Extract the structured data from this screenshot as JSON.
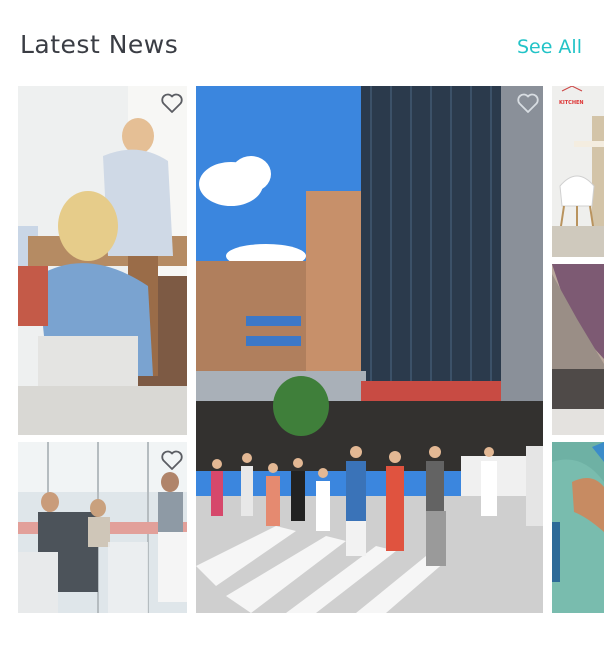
{
  "header": {
    "title": "Latest News",
    "see_all_label": "See All"
  },
  "colors": {
    "accent": "#22c3c7",
    "title": "#3a3d44",
    "heart_stroke": "#ffffff"
  },
  "tiles": [
    {
      "id": "office-meeting",
      "favorite_icon": "heart-outline-icon"
    },
    {
      "id": "city-street",
      "favorite_icon": "heart-outline-icon"
    },
    {
      "id": "glass-office",
      "favorite_icon": "heart-outline-icon"
    },
    {
      "id": "interior-chair",
      "logo_text": "KITCHEN"
    },
    {
      "id": "laptop-desk"
    },
    {
      "id": "hands-paper"
    }
  ]
}
